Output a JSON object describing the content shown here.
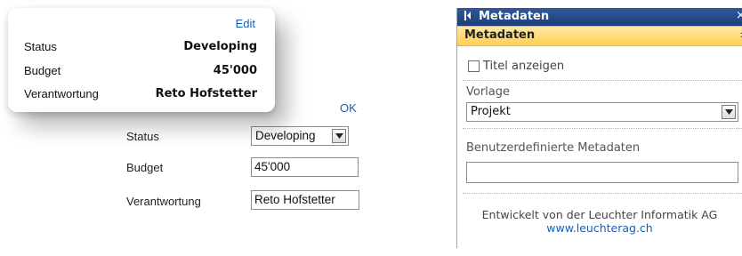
{
  "popup": {
    "edit_label": "Edit",
    "rows": [
      {
        "label": "Status",
        "value": "Developing"
      },
      {
        "label": "Budget",
        "value": "45'000"
      },
      {
        "label": "Verantwortung",
        "value": "Reto Hofstetter"
      }
    ]
  },
  "form": {
    "ok_label": "OK",
    "status_label": "Status",
    "status_value": "Developing",
    "budget_label": "Budget",
    "budget_value": "45'000",
    "owner_label": "Verantwortung",
    "owner_value": "Reto Hofstetter"
  },
  "panel": {
    "header_title": "Metadaten",
    "close_glyph": "×",
    "section_title": "Metadaten",
    "show_title_label": "Titel anzeigen",
    "show_title_checked": false,
    "template_label": "Vorlage",
    "template_value": "Projekt",
    "custom_metadata_label": "Benutzerdefinierte Metadaten",
    "custom_metadata_value": "",
    "footer_text": "Entwickelt von der Leuchter Informatik AG",
    "footer_link": "www.leuchterag.ch"
  },
  "colors": {
    "header_blue": "#2f5899",
    "section_yellow": "#ffcf55",
    "link_blue": "#1a5fb4"
  }
}
